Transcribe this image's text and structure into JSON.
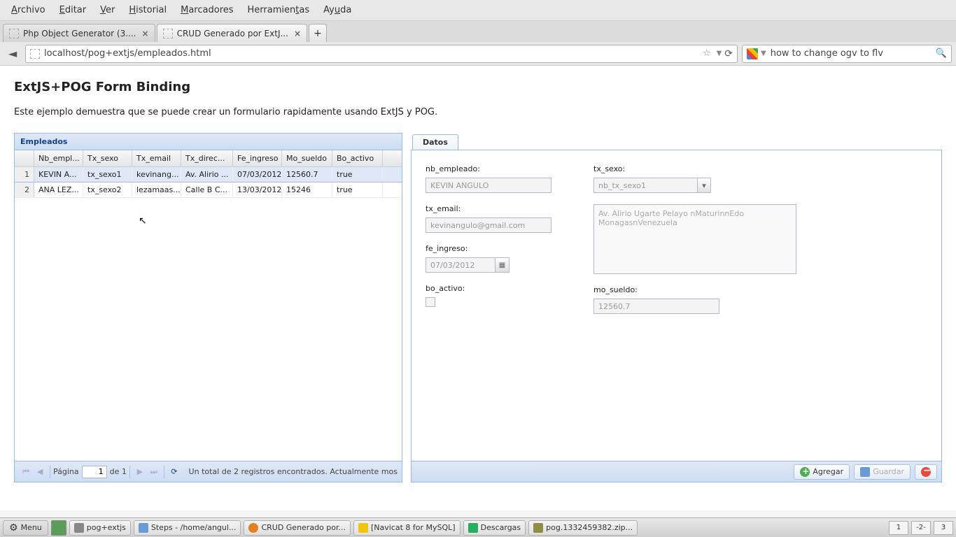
{
  "menubar": [
    "Archivo",
    "Editar",
    "Ver",
    "Historial",
    "Marcadores",
    "Herramientas",
    "Ayuda"
  ],
  "tabs": {
    "t1": "Php Object Generator (3....",
    "t2": "CRUD Generado por ExtJ..."
  },
  "url": "localhost/pog+extjs/empleados.html",
  "search": {
    "value": "how to change ogv to flv"
  },
  "page": {
    "title": "ExtJS+POG Form Binding",
    "desc": "Este ejemplo demuestra que se puede crear un formulario rapidamente usando ExtJS y POG."
  },
  "grid": {
    "title": "Empleados",
    "cols": {
      "num": "",
      "nb": "Nb_empl...",
      "sx": "Tx_sexo",
      "em": "Tx_email",
      "dr": "Tx_direc...",
      "fe": "Fe_ingreso",
      "mo": "Mo_sueldo",
      "bo": "Bo_activo"
    },
    "rows": [
      {
        "num": "1",
        "nb": "KEVIN A...",
        "sx": "tx_sexo1",
        "em": "kevinang...",
        "dr": "Av. Alirio ...",
        "fe": "07/03/2012",
        "mo": "12560.7",
        "bo": "true"
      },
      {
        "num": "2",
        "nb": "ANA LEZ...",
        "sx": "tx_sexo2",
        "em": "lezamaas...",
        "dr": "Calle B C...",
        "fe": "13/03/2012",
        "mo": "15246",
        "bo": "true"
      }
    ],
    "footer": {
      "pagina": "Página",
      "page": "1",
      "of": "de 1",
      "status": "Un total de 2 registros encontrados. Actualmente mos"
    }
  },
  "form": {
    "tab": "Datos",
    "nb_empleado_lbl": "nb_empleado:",
    "nb_empleado": "KEVIN ANGULO",
    "tx_email_lbl": "tx_email:",
    "tx_email": "kevinangulo@gmail.com",
    "fe_ingreso_lbl": "fe_ingreso:",
    "fe_ingreso": "07/03/2012",
    "bo_activo_lbl": "bo_activo:",
    "tx_sexo_lbl": "tx_sexo:",
    "tx_sexo": "nb_tx_sexo1",
    "direc": "Av. Alirio Ugarte Pelayo nMaturinnEdo MonagasnVenezuela",
    "mo_sueldo_lbl": "mo_sueldo:",
    "mo_sueldo": "12560.7"
  },
  "toolbar": {
    "agregar": "Agregar",
    "guardar": "Guardar"
  },
  "taskbar": {
    "menu": "Menu",
    "t1": "pog+extjs",
    "t2": "Steps - /home/angul...",
    "t3": "CRUD Generado por...",
    "t4": "[Navicat 8 for MySQL]",
    "t5": "Descargas",
    "t6": "pog.1332459382.zip...",
    "ws1": "1",
    "ws2": "-2-",
    "ws3": "3"
  }
}
